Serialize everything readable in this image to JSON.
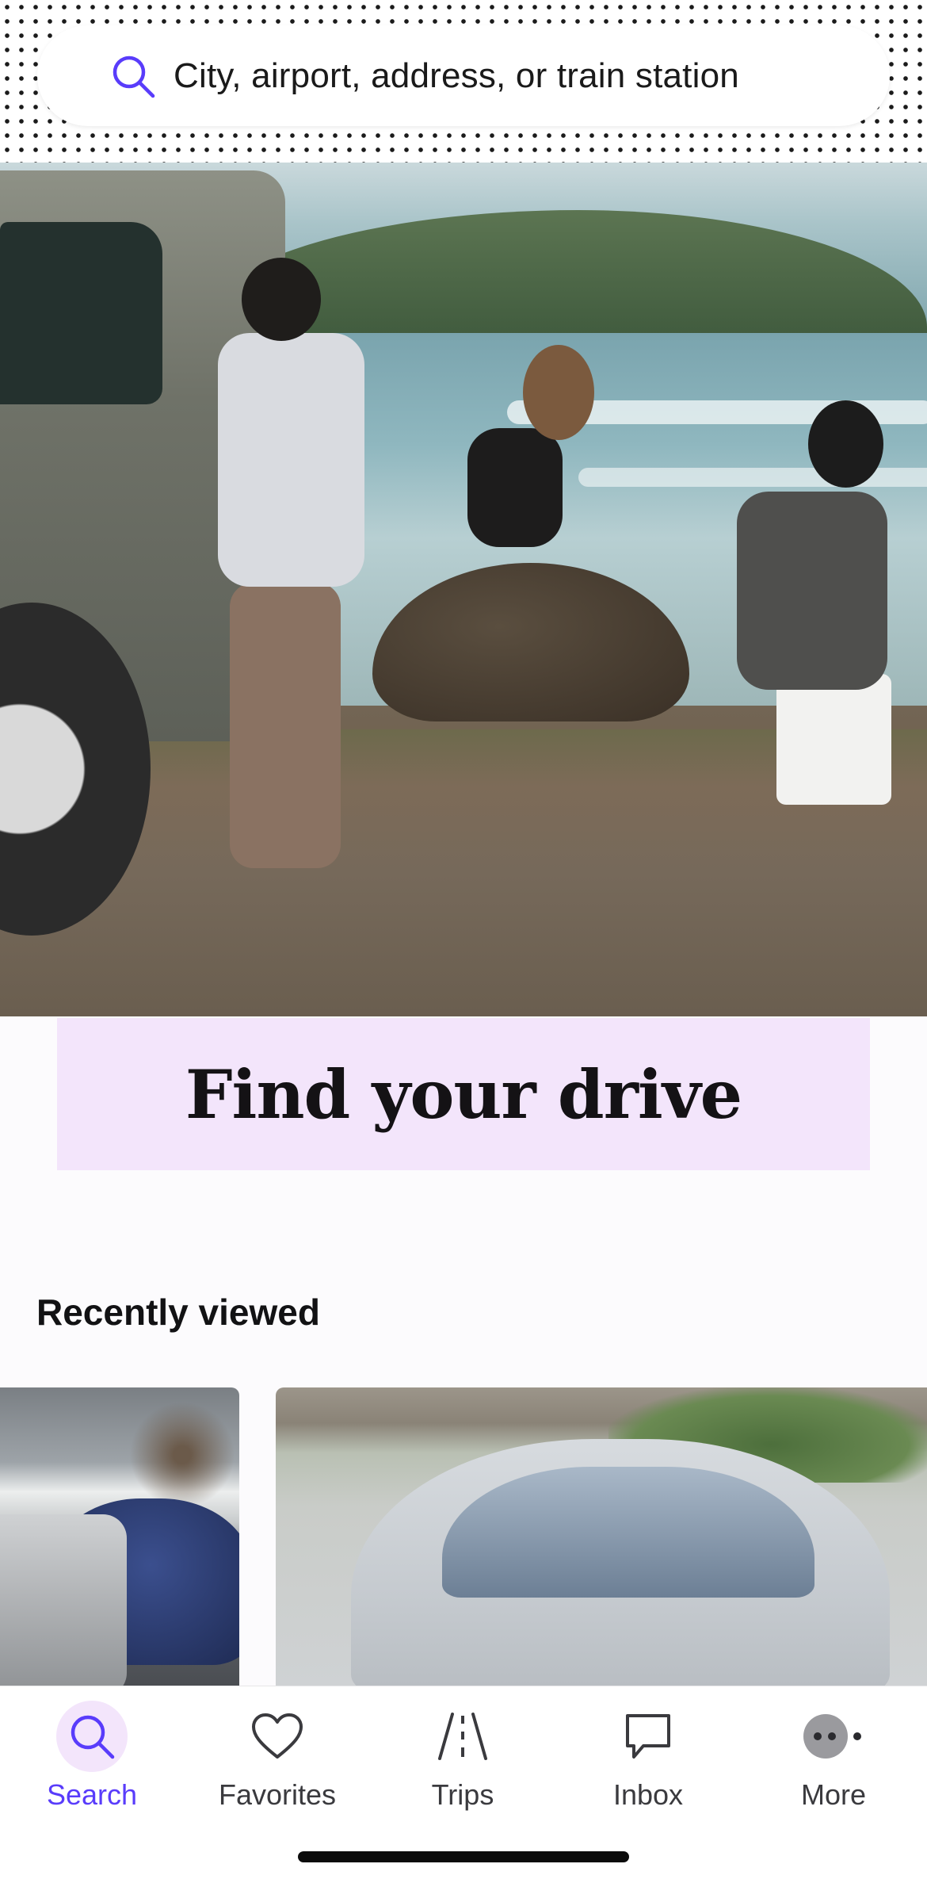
{
  "search": {
    "placeholder": "City, airport, address, or train station"
  },
  "hero": {
    "headline": "Find your drive"
  },
  "recently_viewed": {
    "title": "Recently viewed"
  },
  "nav": {
    "items": [
      {
        "label": "Search",
        "icon": "search-icon",
        "active": true
      },
      {
        "label": "Favorites",
        "icon": "heart-icon",
        "active": false
      },
      {
        "label": "Trips",
        "icon": "road-icon",
        "active": false
      },
      {
        "label": "Inbox",
        "icon": "chat-bubble-icon",
        "active": false
      },
      {
        "label": "More",
        "icon": "more-dots-icon",
        "active": false
      }
    ]
  },
  "colors": {
    "accent": "#593cfb",
    "band": "#f3e5fb",
    "text": "#121214"
  }
}
